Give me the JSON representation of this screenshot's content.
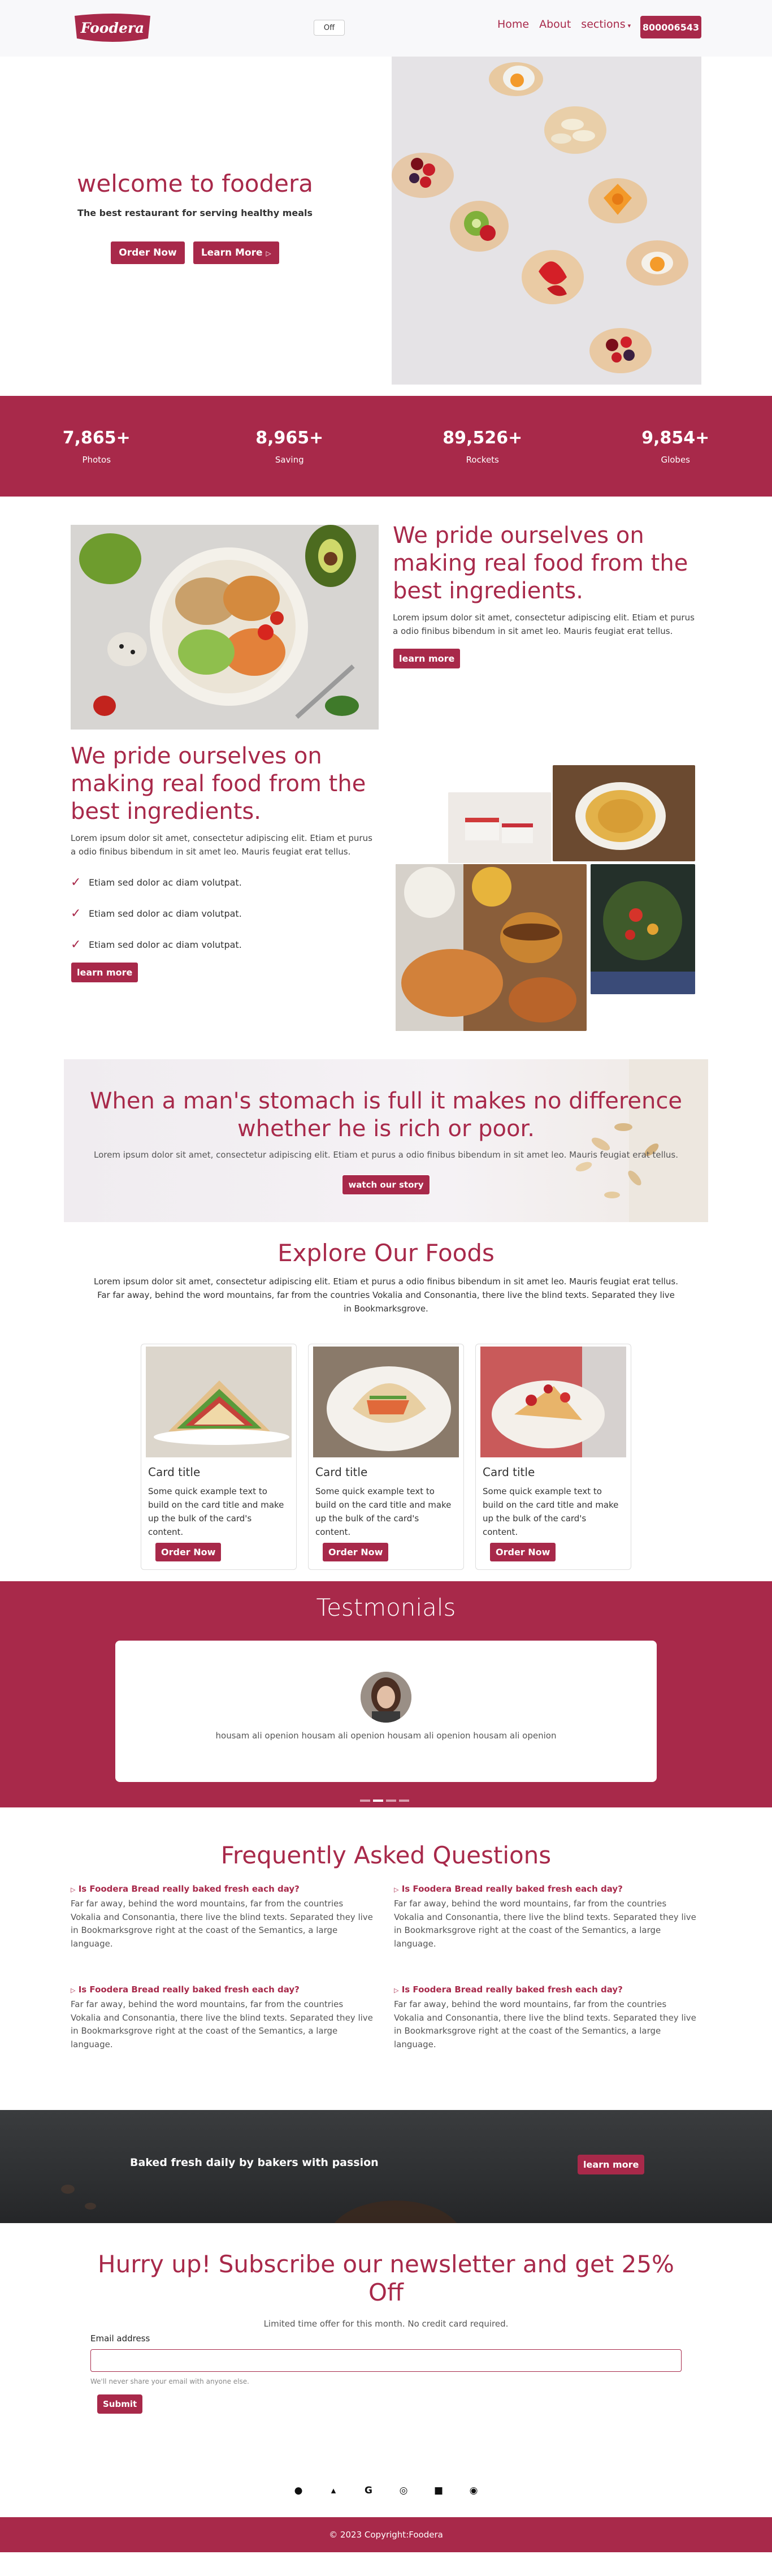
{
  "nav": {
    "logo_text": "Foodera",
    "toggle_label": "Off",
    "links": [
      "Home",
      "About"
    ],
    "dropdown_label": "sections",
    "phone": "800006543"
  },
  "hero": {
    "title": "welcome to foodera",
    "subtitle": "The best restaurant for serving healthy meals",
    "order_btn": "Order Now",
    "learn_btn": "Learn More"
  },
  "stats": [
    {
      "value": "7,865+",
      "label": "Photos"
    },
    {
      "value": "8,965+",
      "label": "Saving"
    },
    {
      "value": "89,526+",
      "label": "Rockets"
    },
    {
      "value": "9,854+",
      "label": "Globes"
    }
  ],
  "section_a": {
    "title": "We pride ourselves on making real food from the best ingredients.",
    "text": "Lorem ipsum dolor sit amet, consectetur adipiscing elit. Etiam et purus a odio finibus bibendum in sit amet leo. Mauris feugiat erat tellus.",
    "button": "learn more"
  },
  "section_b": {
    "title": "We pride ourselves on making real food from the best ingredients.",
    "text": "Lorem ipsum dolor sit amet, consectetur adipiscing elit. Etiam et purus a odio finibus bibendum in sit amet leo. Mauris feugiat erat tellus.",
    "checks": [
      "Etiam sed dolor ac diam volutpat.",
      "Etiam sed dolor ac diam volutpat.",
      "Etiam sed dolor ac diam volutpat."
    ],
    "button": "learn more"
  },
  "story": {
    "title": "When a man's stomach is full it makes no difference whether he is rich or poor.",
    "text": "Lorem ipsum dolor sit amet, consectetur adipiscing elit. Etiam et purus a odio finibus bibendum in sit amet leo. Mauris feugiat erat tellus.",
    "button": "watch our story"
  },
  "explore": {
    "title": "Explore Our Foods",
    "text": "Lorem ipsum dolor sit amet, consectetur adipiscing elit. Etiam et purus a odio finibus bibendum in sit amet leo. Mauris feugiat erat tellus. Far far away, behind the word mountains, far from the countries Vokalia and Consonantia, there live the blind texts. Separated they live in Bookmarksgrove.",
    "cards": [
      {
        "title": "Card title",
        "text": "Some quick example text to build on the card title and make up the bulk of the card's content.",
        "button": "Order Now"
      },
      {
        "title": "Card title",
        "text": "Some quick example text to build on the card title and make up the bulk of the card's content.",
        "button": "Order Now"
      },
      {
        "title": "Card title",
        "text": "Some quick example text to build on the card title and make up the bulk of the card's content.",
        "button": "Order Now"
      }
    ]
  },
  "testimonials": {
    "title": "Testmonials",
    "quote": "housam ali openion housam ali openion housam ali openion housam ali openion"
  },
  "faq": {
    "title": "Frequently Asked Questions",
    "items": [
      {
        "q": "Is Foodera Bread really baked fresh each day?",
        "a": "Far far away, behind the word mountains, far from the countries Vokalia and Consonantia, there live the blind texts. Separated they live in Bookmarksgrove right at the coast of the Semantics, a large language."
      },
      {
        "q": "Is Foodera Bread really baked fresh each day?",
        "a": "Far far away, behind the word mountains, far from the countries Vokalia and Consonantia, there live the blind texts. Separated they live in Bookmarksgrove right at the coast of the Semantics, a large language."
      },
      {
        "q": "Is Foodera Bread really baked fresh each day?",
        "a": "Far far away, behind the word mountains, far from the countries Vokalia and Consonantia, there live the blind texts. Separated they live in Bookmarksgrove right at the coast of the Semantics, a large language."
      },
      {
        "q": "Is Foodera Bread really baked fresh each day?",
        "a": "Far far away, behind the word mountains, far from the countries Vokalia and Consonantia, there live the blind texts. Separated they live in Bookmarksgrove right at the coast of the Semantics, a large language."
      }
    ]
  },
  "baked": {
    "text": "Baked fresh daily by bakers with passion",
    "button": "learn more"
  },
  "newsletter": {
    "title": "Hurry up! Subscribe our newsletter and get 25% Off",
    "subtitle": "Limited time offer for this month. No credit card required.",
    "email_label": "Email address",
    "email_value": "",
    "help": "We'll never share your email with anyone else.",
    "submit": "Submit"
  },
  "social_icons": [
    "facebook-icon",
    "twitter-icon",
    "google-icon",
    "instagram-icon",
    "linkedin-icon",
    "github-icon"
  ],
  "footer": {
    "copyright": "© 2023 Copyright:Foodera"
  },
  "colors": {
    "brand": "#a8294a",
    "dark_banner": "#2e3032",
    "nav_bg": "#f8f8fa"
  }
}
